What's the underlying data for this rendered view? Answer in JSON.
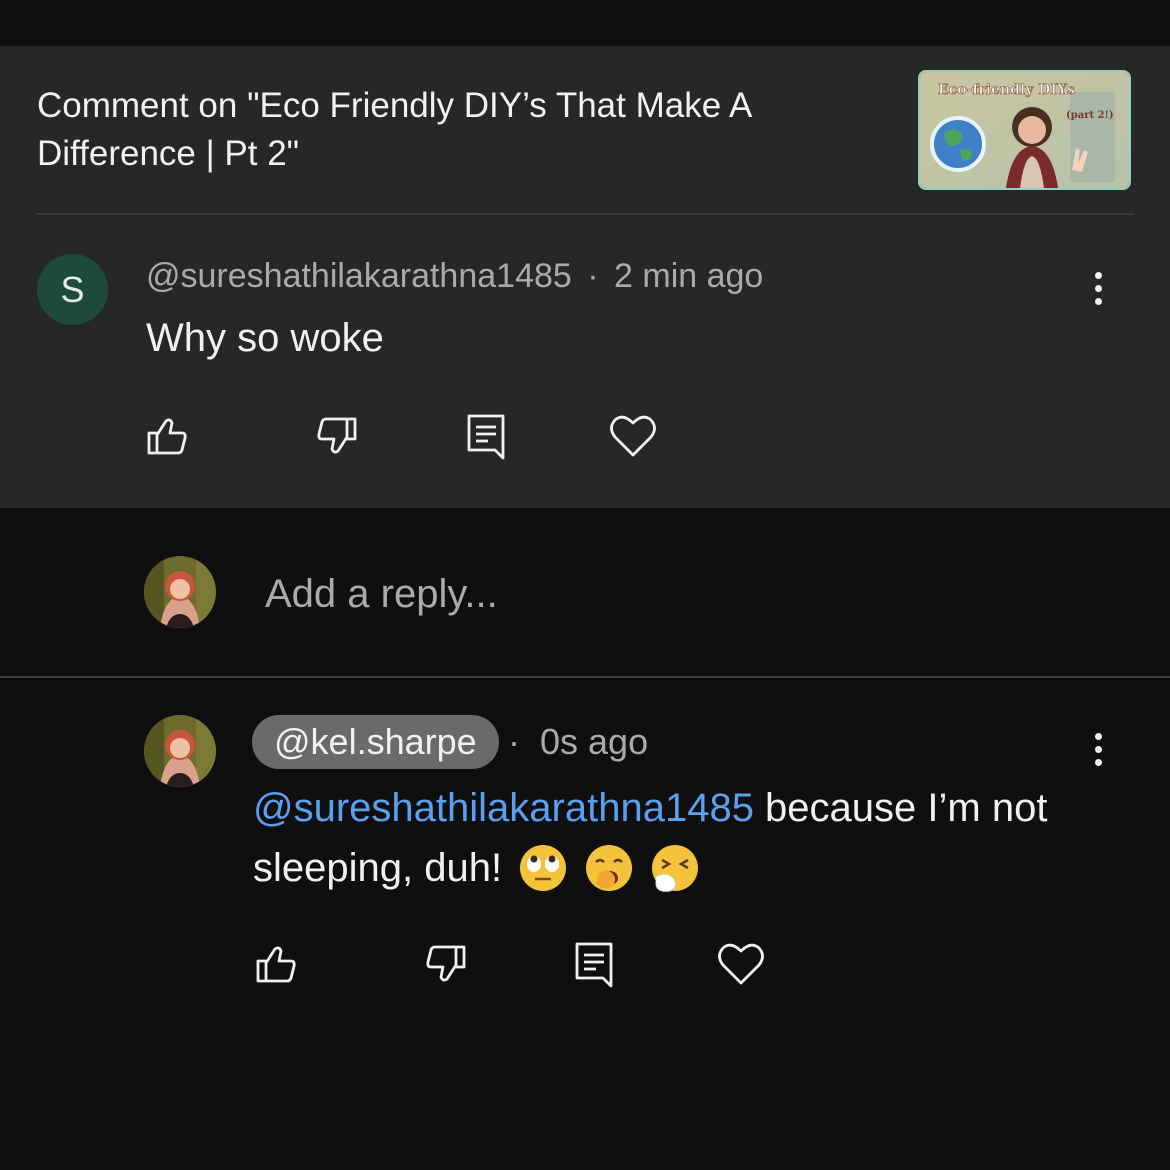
{
  "video": {
    "comment_on_title": "Comment on \"Eco Friendly DIY’s That Make A Difference | Pt 2\"",
    "thumbnail_text_line1": "Eco-friendly DIYs",
    "thumbnail_text_line2": "(part 2!)"
  },
  "comment": {
    "avatar_letter": "S",
    "author": "@sureshathilakarathna1485",
    "separator": "·",
    "time": "2 min ago",
    "text": "Why so woke"
  },
  "reply_box": {
    "placeholder": "Add a reply..."
  },
  "reply": {
    "author": "@kel.sharpe",
    "separator": "·",
    "time": "0s ago",
    "mention": "@sureshathilakarathna1485",
    "text": " because I’m not sleeping, duh!",
    "emojis": [
      "eye-roll-emoji",
      "yawning-emoji",
      "sneezing-emoji"
    ]
  },
  "icons": {
    "like": "thumbs-up-icon",
    "dislike": "thumbs-down-icon",
    "reply": "reply-icon",
    "heart": "heart-icon",
    "more": "more-vertical-icon"
  },
  "colors": {
    "background": "#0f0f0f",
    "panel": "#272727",
    "mention": "#5aa0f0",
    "avatar_letter_bg": "#1e4a3c",
    "pill": "#6a6a6a"
  }
}
